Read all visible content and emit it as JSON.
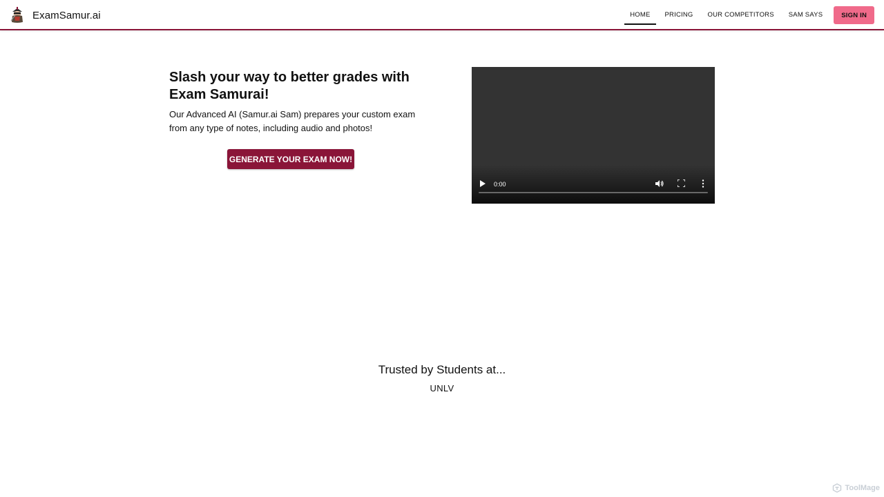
{
  "header": {
    "brand_name": "ExamSamur.ai",
    "logo_icon": "samurai-logo-icon",
    "nav": [
      {
        "label": "HOME",
        "active": true
      },
      {
        "label": "PRICING",
        "active": false
      },
      {
        "label": "OUR COMPETITORS",
        "active": false
      },
      {
        "label": "SAM SAYS",
        "active": false
      }
    ],
    "sign_in_label": "SIGN IN"
  },
  "hero": {
    "title": "Slash your way to better grades with Exam Samurai!",
    "description": "Our Advanced AI (Samur.ai Sam) prepares your custom exam from any type of notes, including audio and photos!",
    "cta_label": "GENERATE YOUR EXAM NOW!"
  },
  "video": {
    "time": "0:00",
    "progress": 0
  },
  "trusted": {
    "title": "Trusted by Students at...",
    "school": "UNLV"
  },
  "watermark": {
    "text": "ToolMage"
  },
  "colors": {
    "brand": "#8a1538",
    "sign_in": "#f06a8a",
    "video_bg": "#333333"
  }
}
